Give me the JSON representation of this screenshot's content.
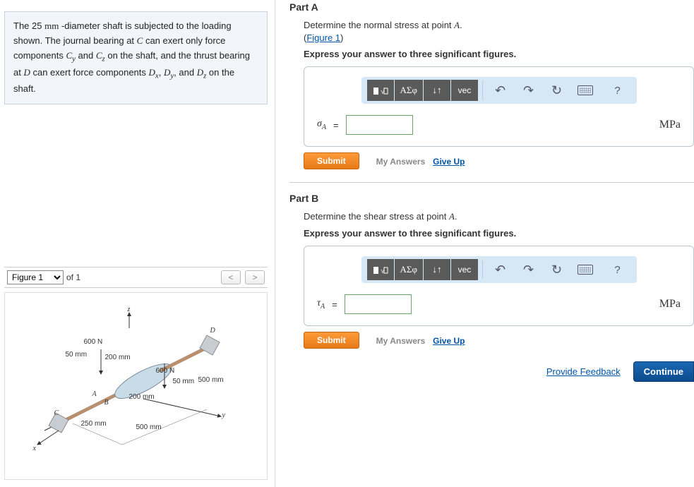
{
  "problem": {
    "text_parts": [
      "The 25 ",
      "mm",
      " -diameter shaft is subjected to the loading shown. The journal bearing at ",
      "C",
      " can exert only force components ",
      "C",
      "y",
      " and ",
      "C",
      "z",
      " on the shaft, and the thrust bearing at ",
      "D",
      " can exert force components ",
      "D",
      "x",
      ", ",
      "D",
      "y",
      ", and ",
      "D",
      "z",
      " on the shaft."
    ]
  },
  "figure_selector": {
    "selected": "Figure 1",
    "of_text": "of 1",
    "prev": "<",
    "next": ">"
  },
  "figure_labels": {
    "z": "z",
    "y": "y",
    "x": "x",
    "A": "A",
    "B": "B",
    "C": "C",
    "D": "D",
    "f600a": "600 N",
    "f600b": "600 N",
    "d50a": "50 mm",
    "d200a": "200 mm",
    "d50b": "50 mm",
    "d500a": "500 mm",
    "d200b": "200 mm",
    "d250": "250 mm",
    "d500b": "500 mm"
  },
  "partA": {
    "title": "Part A",
    "prompt": "Determine the normal stress at point ",
    "point": "A",
    "period": ".",
    "fig_ref_open": "(",
    "fig_ref": "Figure 1",
    "fig_ref_close": ")",
    "instruction": "Express your answer to three significant figures.",
    "var": "σ",
    "sub": "A",
    "eq": "=",
    "unit": "MPa",
    "submit": "Submit",
    "my_answers": "My Answers",
    "giveup": "Give Up"
  },
  "partB": {
    "title": "Part B",
    "prompt": "Determine the shear stress at point ",
    "point": "A",
    "period": ".",
    "instruction": "Express your answer to three significant figures.",
    "var": "τ",
    "sub": "A",
    "eq": "=",
    "unit": "MPa",
    "submit": "Submit",
    "my_answers": "My Answers",
    "giveup": "Give Up"
  },
  "toolbar": {
    "template": "x√x",
    "greek": "ΑΣφ",
    "arrows": "↓↑",
    "vec": "vec",
    "undo": "↶",
    "redo": "↷",
    "reset": "↻",
    "help": "?"
  },
  "footer": {
    "feedback": "Provide Feedback",
    "continue": "Continue"
  }
}
